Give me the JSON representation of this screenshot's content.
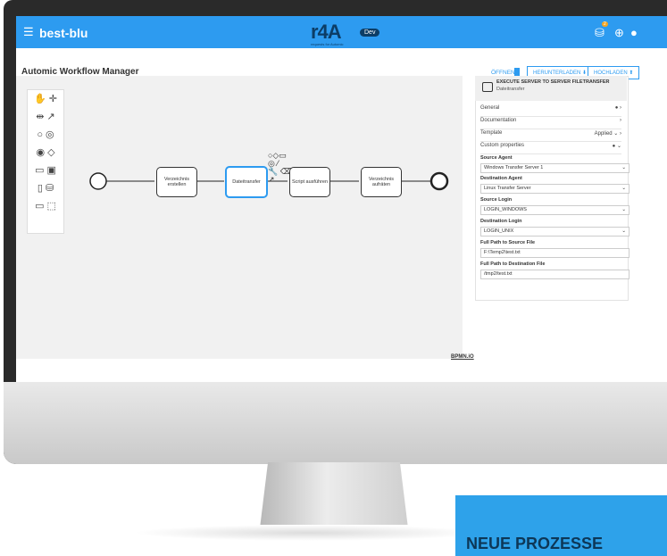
{
  "app": {
    "brand": "best-blu",
    "logo": "r4A",
    "env_tag": "Dev",
    "logo_sub": "requests for Automic",
    "page_title": "Automic Workflow Manager",
    "notif_count": "2"
  },
  "toolbar": {
    "open_label": "ÖFFNEN",
    "download_label": "HERUNTERLADEN",
    "upload_label": "HOCHLADEN"
  },
  "diagram": {
    "tasks": [
      "Verzeichnis erstellen",
      "Dateitransfer",
      "Script ausführen",
      "Verzeichnis aufräten"
    ],
    "watermark": "BPMN.iO"
  },
  "panel": {
    "title": "EXECUTE SERVER TO SERVER FILETRANSFER",
    "subtitle": "Dateitransfer",
    "sections": [
      "General",
      "Documentation",
      "Template",
      "Custom properties"
    ],
    "template_value": "Applied",
    "fields": [
      {
        "label": "Source Agent",
        "value": "Windows Transfer Server 1"
      },
      {
        "label": "Destination Agent",
        "value": "Linux Transfer Server"
      },
      {
        "label": "Source Login",
        "value": "LOGIN_WINDOWS"
      },
      {
        "label": "Destination Login",
        "value": "LOGIN_UNIX"
      },
      {
        "label": "Full Path to Source File",
        "value": "F:\\Temp2\\test.txt"
      },
      {
        "label": "Full Path to Destination File",
        "value": "/tmp2/test.txt"
      }
    ]
  },
  "banner": {
    "text": "NEUE PROZESSE"
  },
  "colors": {
    "accent": "#2d9bf0",
    "banner": "#2ea2ea"
  }
}
